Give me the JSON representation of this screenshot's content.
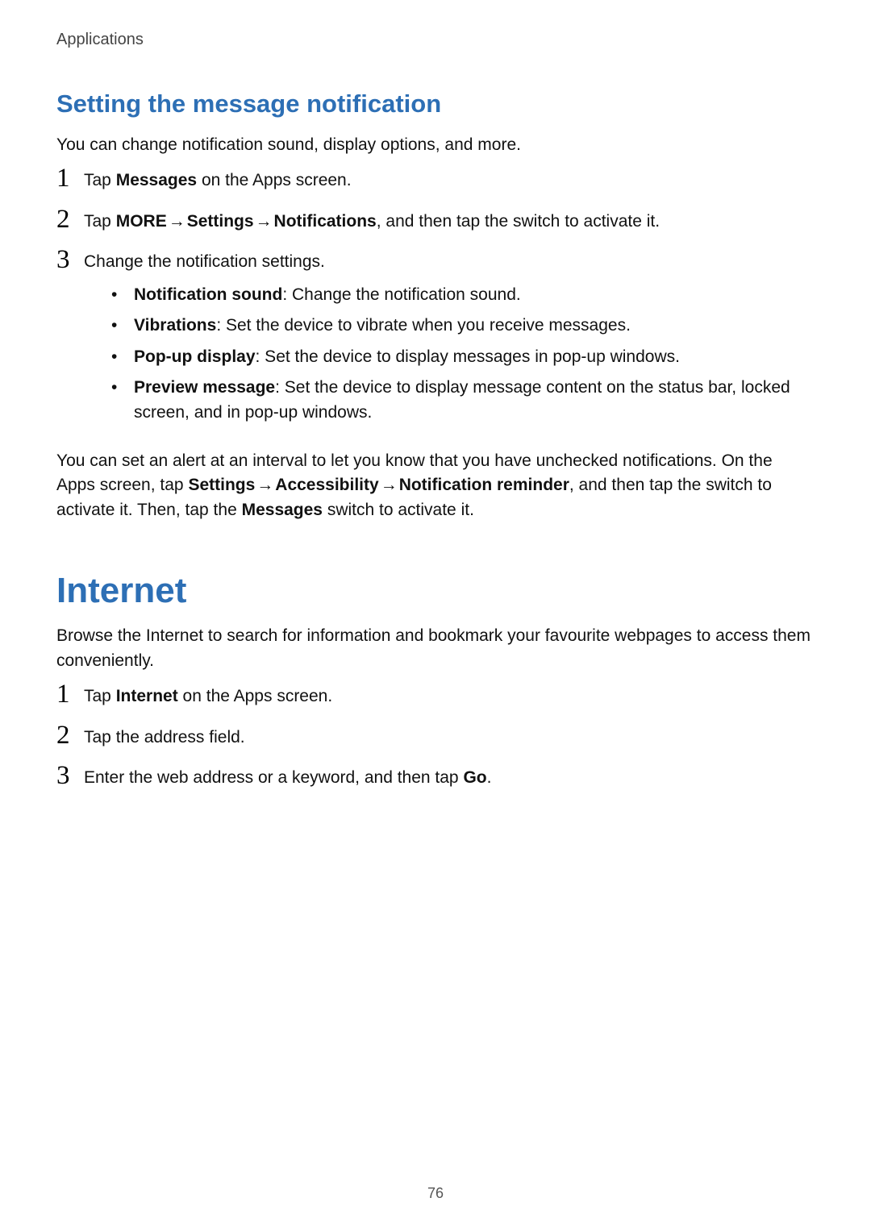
{
  "header": "Applications",
  "s1": {
    "title": "Setting the message notification",
    "intro": "You can change notification sound, display options, and more.",
    "step1_pre": "Tap ",
    "step1_b": "Messages",
    "step1_post": " on the Apps screen.",
    "step2_pre": "Tap ",
    "step2_b1": "MORE",
    "step2_arr1": " → ",
    "step2_b2": "Settings",
    "step2_arr2": " → ",
    "step2_b3": "Notifications",
    "step2_post": ", and then tap the switch to activate it.",
    "step3": "Change the notification settings.",
    "bullets": [
      {
        "b": "Notification sound",
        "t": ": Change the notification sound."
      },
      {
        "b": "Vibrations",
        "t": ": Set the device to vibrate when you receive messages."
      },
      {
        "b": "Pop-up display",
        "t": ": Set the device to display messages in pop-up windows."
      },
      {
        "b": "Preview message",
        "t": ": Set the device to display message content on the status bar, locked screen, and in pop-up windows."
      }
    ],
    "outro_pre": "You can set an alert at an interval to let you know that you have unchecked notifications. On the Apps screen, tap ",
    "outro_b1": "Settings",
    "outro_arr1": " → ",
    "outro_b2": "Accessibility",
    "outro_arr2": " → ",
    "outro_b3": "Notification reminder",
    "outro_mid": ", and then tap the switch to activate it. Then, tap the ",
    "outro_b4": "Messages",
    "outro_post": " switch to activate it."
  },
  "s2": {
    "title": "Internet",
    "intro": "Browse the Internet to search for information and bookmark your favourite webpages to access them conveniently.",
    "step1_pre": "Tap ",
    "step1_b": "Internet",
    "step1_post": " on the Apps screen.",
    "step2": "Tap the address field.",
    "step3_pre": "Enter the web address or a keyword, and then tap ",
    "step3_b": "Go",
    "step3_post": "."
  },
  "nums": {
    "n1": "1",
    "n2": "2",
    "n3": "3"
  },
  "dot": "•",
  "pageNumber": "76"
}
